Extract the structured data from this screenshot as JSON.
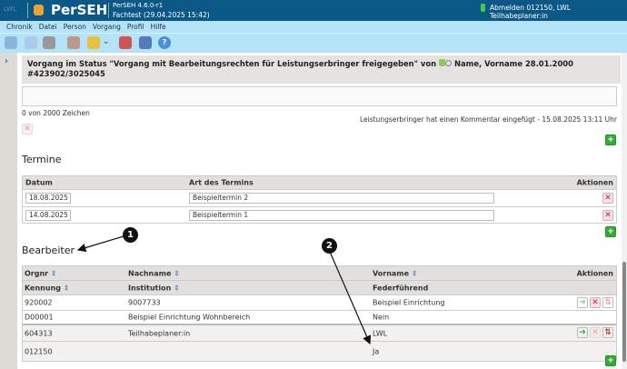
{
  "app": {
    "lwl": "LWL",
    "name": "PerSEH",
    "version": "PerSEH 4.6.0-r1",
    "env": "Fachtest (29.04.2025 15:42)",
    "user": "Abmelden 012150, LWL Teilhabeplaner:in"
  },
  "menu": [
    "Chronik",
    "Datei",
    "Person",
    "Vorgang",
    "Profil",
    "Hilfe"
  ],
  "toolbar_icons": [
    "save-icon",
    "undo-icon",
    "print-icon",
    "person-search-icon",
    "folder-add-icon",
    "network-icon",
    "shield-info-icon",
    "help-icon"
  ],
  "header": {
    "line1": "Vorgang im Status \"Vorgang mit Bearbeitungsrechten für Leistungserbringer freigegeben\" von",
    "person": "Name, Vorname 28.01.2000",
    "line2": "#423902/3025045"
  },
  "comment": {
    "counter": "0 von 2000 Zeichen",
    "info": "Leistungserbringer hat einen Kommentar eingefügt - 15.08.2025 13:11 Uhr"
  },
  "termine": {
    "title": "Termine",
    "headers": [
      "Datum",
      "Art des Termins",
      "Aktionen"
    ],
    "rows": [
      {
        "datum": "18.08.2025",
        "art": "Beispieltermin 2"
      },
      {
        "datum": "14.08.2025",
        "art": "Beispieltermin 1"
      }
    ]
  },
  "bearbeiter": {
    "title": "Bearbeiter",
    "headers1": [
      "Orgnr",
      "Nachname",
      "Vorname",
      "Aktionen"
    ],
    "headers2": [
      "Kennung",
      "Institution",
      "Federführend"
    ],
    "rows": [
      {
        "orgnr": "920002",
        "nachname": "9007733",
        "vorname": "Beispiel Einrichtung",
        "kennung": "D00001",
        "institution": "Beispiel Einrichtung Wohnbereich",
        "federfuehrend": "Nein"
      },
      {
        "orgnr": "604313",
        "nachname": "Teilhabeplaner:in",
        "vorname": "LWL",
        "kennung": "012150",
        "institution": "",
        "federfuehrend": "Ja"
      }
    ]
  },
  "annotations": [
    "1",
    "2"
  ],
  "colors": {
    "topbar": "#0b5786",
    "menubar": "#b4e3f8",
    "header": "#e6e2df"
  }
}
